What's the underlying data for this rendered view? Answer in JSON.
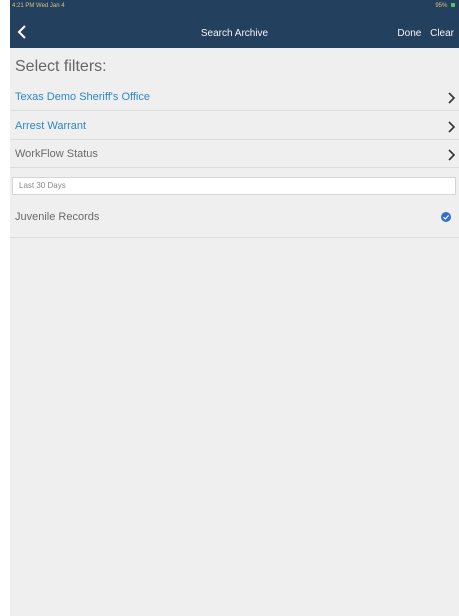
{
  "status_bar": {
    "time_date": "4:21 PM  Wed Jan 4",
    "battery": "95%"
  },
  "nav": {
    "title": "Search Archive",
    "done_label": "Done",
    "clear_label": "Clear"
  },
  "filters": {
    "heading": "Select filters:",
    "agency": "Texas Demo Sheriff's Office",
    "warrant_type": "Arrest Warrant",
    "workflow_status": "WorkFlow Status",
    "date_range": "Last 30 Days",
    "juvenile_records": "Juvenile Records"
  },
  "colors": {
    "header_bg": "#24405f",
    "link_blue": "#2d87c7",
    "check_blue": "#2f6fce"
  },
  "icons": {
    "back": "chevron-left-icon",
    "row_arrow": "chevron-right-icon",
    "checked": "checkmark-circle-icon"
  }
}
